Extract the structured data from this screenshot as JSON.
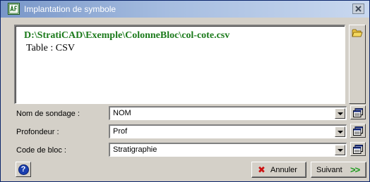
{
  "window": {
    "title": "Implantation de symbole",
    "icon": "app-logo-icon",
    "close_icon": "close-icon"
  },
  "content": {
    "path": "D:\\StratiCAD\\Exemple\\ColonneBloc\\col-cote.csv",
    "table": "Table : CSV",
    "open_icon": "open-folder-icon"
  },
  "fields": [
    {
      "label": "Nom de sondage :",
      "value": "NOM"
    },
    {
      "label": "Profondeur :",
      "value": "Prof"
    },
    {
      "label": "Code de bloc :",
      "value": "Stratigraphie"
    }
  ],
  "buttons": {
    "help_label": "?",
    "cancel_label": "Annuler",
    "next_label": "Suivant",
    "next_arrows": ">>"
  },
  "colors": {
    "path_text": "#1b7a1b",
    "cancel_icon": "#cc1111",
    "next_arrows": "#1a9a1a"
  }
}
